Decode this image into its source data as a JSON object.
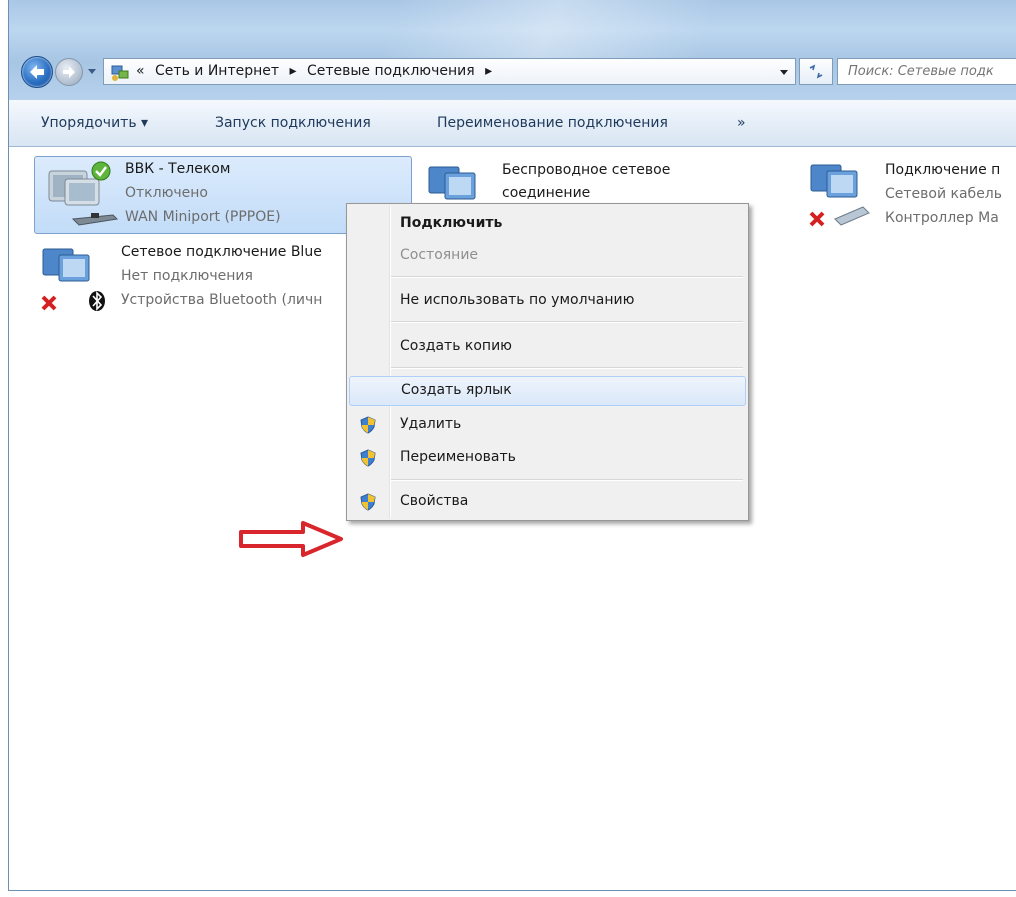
{
  "address_bar": {
    "overflow": "«",
    "crumbs": [
      "Сеть и Интернет",
      "Сетевые подключения"
    ],
    "separator": "▸"
  },
  "search": {
    "placeholder": "Поиск: Сетевые подк"
  },
  "toolbar": {
    "organize": "Упорядочить ▾",
    "start_connection": "Запуск подключения",
    "rename_connection": "Переименование подключения",
    "more": "»"
  },
  "connections": [
    {
      "name": "ВВК - Телеком",
      "status": "Отключено",
      "device": "WAN Miniport (PPPOE)"
    },
    {
      "name": "Беспроводное сетевое",
      "name2": "соединение"
    },
    {
      "name": "Подключение п",
      "status": "Сетевой кабель",
      "device": "Контроллер Ma"
    },
    {
      "name": "Сетевое подключение Blue",
      "status": "Нет подключения",
      "device": "Устройства Bluetooth (личн"
    }
  ],
  "context_menu": {
    "connect": "Подключить",
    "status": "Состояние",
    "not_default": "Не использовать по умолчанию",
    "copy": "Создать копию",
    "shortcut": "Создать ярлык",
    "delete": "Удалить",
    "rename": "Переименовать",
    "properties": "Свойства"
  },
  "colors": {
    "arrow": "#d9262c",
    "selection": "#c2dcf8",
    "titlebar": "#a9c7e6"
  }
}
